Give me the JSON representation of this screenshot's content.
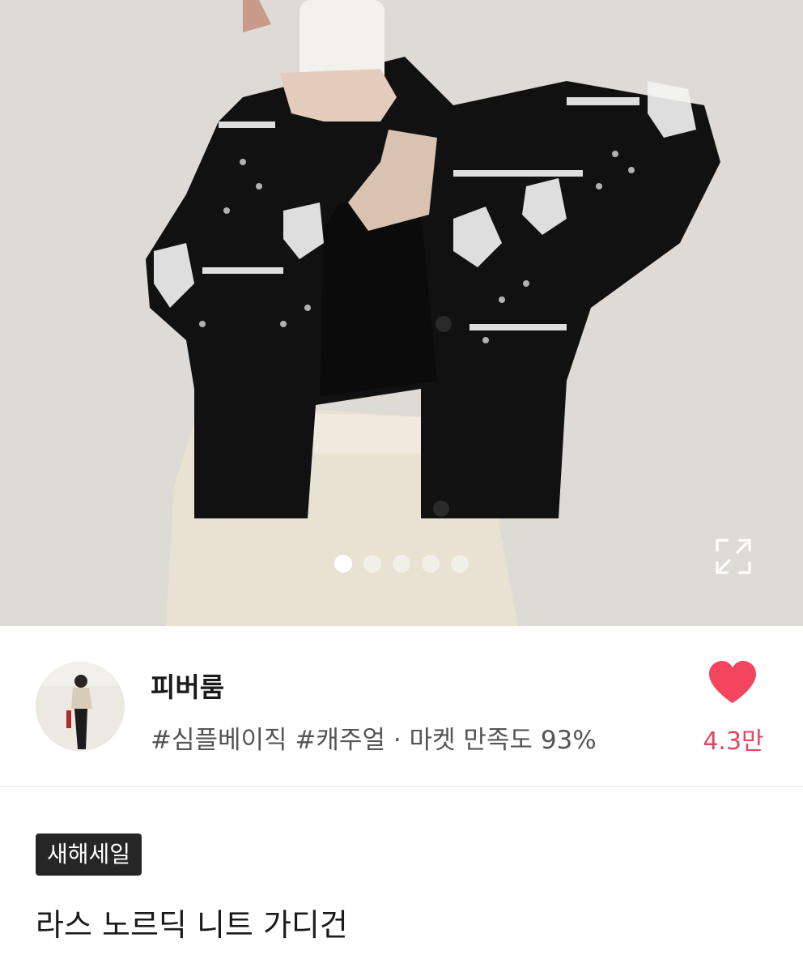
{
  "gallery": {
    "image_alt": "product photo",
    "page_count": 5,
    "active_index": 0,
    "expand_icon": "expand-icon"
  },
  "shop": {
    "name": "피버룸",
    "tags": "#심플베이직 #캐주얼 · 마켓 만족도 93%",
    "like_count": "4.3만",
    "like_icon": "heart-icon",
    "like_color": "#f4455e"
  },
  "product": {
    "badge": "새해세일",
    "title": "라스 노르딕 니트 가디건"
  }
}
